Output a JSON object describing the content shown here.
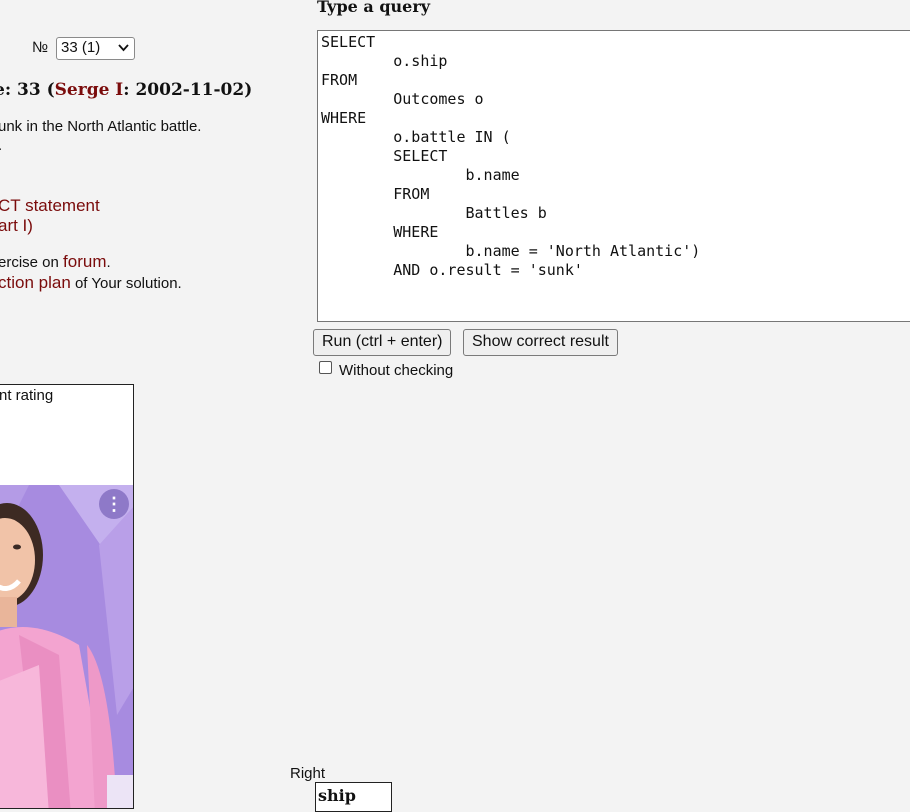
{
  "exercise": {
    "number_label": "№",
    "selected": "33 (1)",
    "title_prefix": "e: 33 (",
    "author": "Serge I",
    "title_suffix": ": 2002-11-02)",
    "description_line1": "unk in the North Atlantic battle.",
    "description_line2": ".",
    "statement_line1": "CT statement",
    "statement_line2": "art I)",
    "forum_prefix": "ercise on ",
    "forum_link": "forum",
    "forum_suffix": ".",
    "plan_link": "ction plan",
    "plan_suffix": " of Your solution."
  },
  "rating": {
    "label": "nt rating"
  },
  "query": {
    "heading": "Type a query",
    "sql": "SELECT\n        o.ship\nFROM\n        Outcomes o\nWHERE\n        o.battle IN (\n        SELECT\n                b.name\n        FROM\n                Battles b\n        WHERE\n                b.name = 'North Atlantic')\n        AND o.result = 'sunk'"
  },
  "buttons": {
    "run": "Run (ctrl + enter)",
    "show": "Show correct result",
    "without_checking": "Without checking"
  },
  "result": {
    "label": "Right",
    "column": "ship"
  },
  "icons": {
    "ad_menu": "kebab-menu-icon",
    "select_arrow": "chevron-down-icon"
  }
}
